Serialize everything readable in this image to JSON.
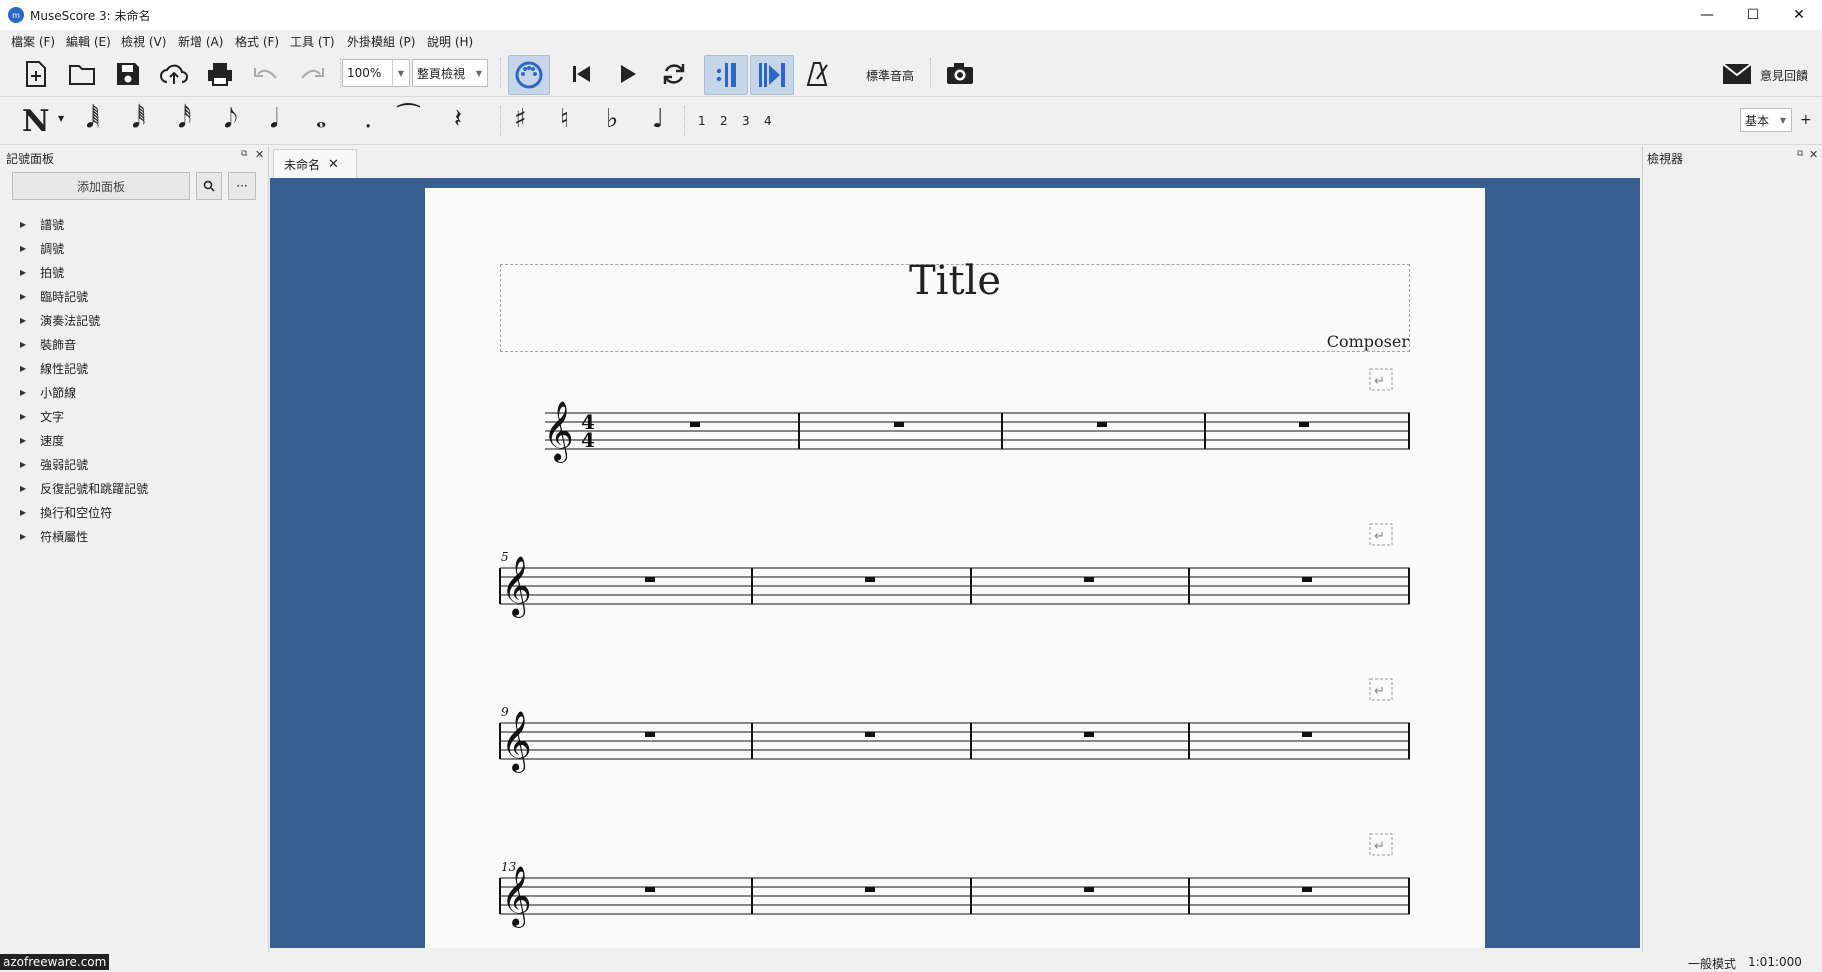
{
  "window": {
    "title": "MuseScore 3: 未命名",
    "minimize": "—",
    "maximize": "☐",
    "close": "✕"
  },
  "menu": [
    "檔案 (F)",
    "編輯 (E)",
    "檢視 (V)",
    "新增 (A)",
    "格式 (F)",
    "工具 (T)",
    "外掛模組 (P)",
    "說明 (H)"
  ],
  "toolbar": {
    "zoom": "100%",
    "view_mode": "整頁檢視",
    "concert_pitch": "標準音高",
    "feedback": "意見回饋"
  },
  "note_input": {
    "voices": [
      "1",
      "2",
      "3",
      "4"
    ],
    "workspace": "基本",
    "add": "+"
  },
  "palette": {
    "title": "記號面板",
    "add_button": "添加面板",
    "more": "···",
    "items": [
      "譜號",
      "調號",
      "拍號",
      "臨時記號",
      "演奏法記號",
      "裝飾音",
      "線性記號",
      "小節線",
      "文字",
      "速度",
      "強弱記號",
      "反復記號和跳躍記號",
      "換行和空位符",
      "符槓屬性"
    ]
  },
  "inspector": {
    "title": "檢視器"
  },
  "tab": {
    "label": "未命名",
    "close": "✕"
  },
  "score": {
    "title": "Title",
    "composer": "Composer",
    "systems": [
      {
        "measure_number": ""
      },
      {
        "measure_number": "5"
      },
      {
        "measure_number": "9"
      },
      {
        "measure_number": "13"
      }
    ],
    "time_signature": {
      "top": "4",
      "bottom": "4"
    }
  },
  "status": {
    "mode": "一般模式",
    "position": "1:01:000"
  },
  "watermark": "azofreeware.com",
  "colors": {
    "canvas": "#385f92",
    "page": "#fafafa",
    "accent": "#2a68c4"
  }
}
